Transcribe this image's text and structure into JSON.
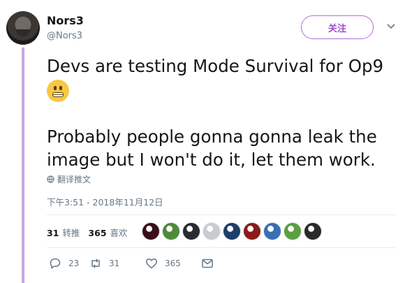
{
  "user": {
    "name": "Nors3",
    "handle": "@Nors3",
    "follow_label": "关注"
  },
  "tweet": {
    "paragraph1": "Devs are testing Mode Survival for Op9",
    "emoji": "grimacing-face",
    "paragraph2": "Probably people gonna gonna leak the image but I won't do it, let them work.",
    "translate_label": "翻译推文",
    "timestamp": "下午3:51 - 2018年11月12日"
  },
  "stats": {
    "retweets_count": "31",
    "retweets_label": "转推",
    "likes_count": "365",
    "likes_label": "喜欢"
  },
  "likers": [
    {
      "name": "liker-1",
      "color": "#3a0f17"
    },
    {
      "name": "liker-2",
      "color": "#4f8a3b"
    },
    {
      "name": "liker-3",
      "color": "#2b2b33"
    },
    {
      "name": "liker-4",
      "color": "#c8ccd1"
    },
    {
      "name": "liker-5",
      "color": "#1f3e6b"
    },
    {
      "name": "liker-6",
      "color": "#8b1a1a"
    },
    {
      "name": "liker-7",
      "color": "#3b6fb3"
    },
    {
      "name": "liker-8",
      "color": "#5aa03e"
    },
    {
      "name": "liker-9",
      "color": "#2a2a2a"
    }
  ],
  "actions": {
    "reply_count": "23",
    "retweet_count": "31",
    "like_count": "365"
  },
  "colors": {
    "accent": "#9b4fc7",
    "thread_line": "#c9a6e6",
    "muted_text": "#657786"
  }
}
